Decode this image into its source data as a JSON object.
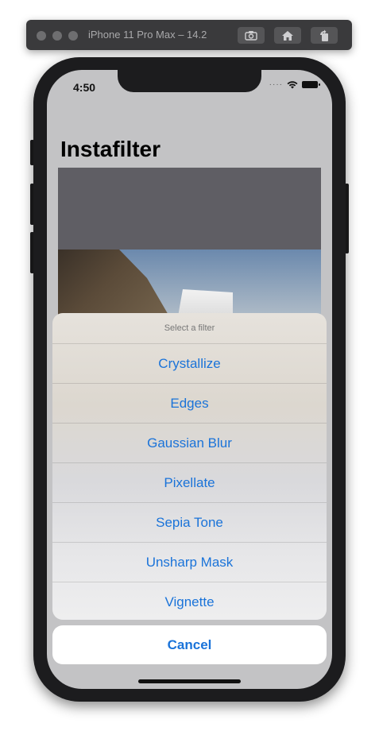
{
  "simulator": {
    "title": "iPhone 11 Pro Max – 14.2",
    "buttons": [
      "screenshot-icon",
      "home-icon",
      "rotate-icon"
    ]
  },
  "status_bar": {
    "time": "4:50",
    "signal": "····"
  },
  "app": {
    "title": "Instafilter"
  },
  "action_sheet": {
    "title": "Select a filter",
    "options": [
      {
        "label": "Crystallize"
      },
      {
        "label": "Edges"
      },
      {
        "label": "Gaussian Blur"
      },
      {
        "label": "Pixellate"
      },
      {
        "label": "Sepia Tone"
      },
      {
        "label": "Unsharp Mask"
      },
      {
        "label": "Vignette"
      }
    ],
    "cancel_label": "Cancel"
  },
  "colors": {
    "accent": "#1a73d9",
    "overlay": "#c3c3c5"
  }
}
